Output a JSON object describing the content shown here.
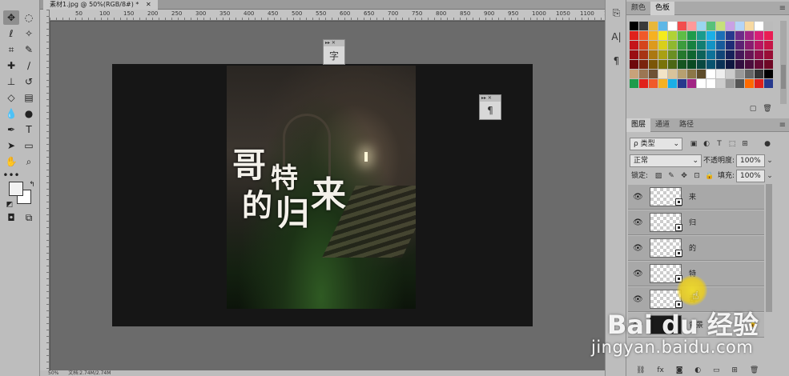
{
  "document": {
    "tab_title": "素材1.jpg @ 50%(RGB/8#) *",
    "ruler_labels": [
      "50",
      "100",
      "150",
      "200",
      "250",
      "300",
      "350",
      "400",
      "450",
      "500",
      "550",
      "600",
      "650",
      "700",
      "750",
      "800",
      "850",
      "900",
      "950",
      "1000",
      "1050",
      "1100",
      "1150"
    ],
    "zoom": "50%",
    "doc_info": "文档:2.74M/2.74M"
  },
  "artwork": {
    "title_chars": [
      "哥",
      "特",
      "的",
      "归",
      "来"
    ]
  },
  "floating_panels": [
    {
      "name": "character-panel",
      "icon": "字"
    },
    {
      "name": "paragraph-panel",
      "icon": "¶"
    }
  ],
  "color_panel": {
    "tabs": [
      "颜色",
      "色板"
    ],
    "active_tab": "色板",
    "swatches": [
      "#000000",
      "#3a3a3a",
      "#e8b73a",
      "#5eb7e6",
      "#ffffff",
      "#f24d4d",
      "#ff9999",
      "#9ad6f0",
      "#57c17a",
      "#c6e07b",
      "#c9a1e5",
      "#b3d4f7",
      "#f7d9a1",
      "#ffffff",
      "#bbbbbb",
      "#e0211c",
      "#f0592a",
      "#f6b121",
      "#f5ec1c",
      "#b0d235",
      "#5ebd46",
      "#1e9b4b",
      "#199b8d",
      "#1aafe6",
      "#1b6fb7",
      "#27398d",
      "#6e2c88",
      "#a22585",
      "#d81e76",
      "#ea1c54",
      "#c4151a",
      "#d4441d",
      "#dd9a1c",
      "#d8cf1a",
      "#8fb82f",
      "#3c9c3d",
      "#178140",
      "#127e72",
      "#1393c4",
      "#175b9b",
      "#1e2c76",
      "#5c2273",
      "#8a1d6f",
      "#b81763",
      "#c61547",
      "#9a0e12",
      "#a73414",
      "#ab7811",
      "#a9a013",
      "#6b8f22",
      "#25782d",
      "#0f6530",
      "#0d6259",
      "#0d7299",
      "#104578",
      "#16215a",
      "#461859",
      "#6a1555",
      "#8e104b",
      "#990e36",
      "#6e080b",
      "#7a240d",
      "#7b5608",
      "#79730b",
      "#4c6716",
      "#155520",
      "#094a22",
      "#084840",
      "#08536f",
      "#0a3156",
      "#0e1640",
      "#320f40",
      "#4c0d3d",
      "#660935",
      "#6e0725",
      "#c8a27a",
      "#9b7653",
      "#6f5134",
      "#f2e3c6",
      "#d8c39b",
      "#b7a070",
      "#8c7647",
      "#5e4c2a",
      "#ffffff",
      "#eeeeee",
      "#cccccc",
      "#999999",
      "#666666",
      "#333333",
      "#000000",
      "#1e9b4b",
      "#e0211c",
      "#f0592a",
      "#f6b121",
      "#1aafe6",
      "#27398d",
      "#a22585",
      "#ffffff",
      "#ffffff",
      "#cccccc",
      "#999999",
      "#555555",
      "#ff6a00",
      "#e0211c",
      "#27398d"
    ]
  },
  "layers_panel": {
    "tabs": [
      "图层",
      "通道",
      "路径"
    ],
    "active_tab": "图层",
    "filter_label": "ρ 类型",
    "blend_mode": "正常",
    "opacity_label": "不透明度:",
    "opacity_value": "100%",
    "lock_label": "锁定:",
    "fill_label": "填充:",
    "fill_value": "100%",
    "layers": [
      {
        "name": "来"
      },
      {
        "name": "归"
      },
      {
        "name": "的"
      },
      {
        "name": "特"
      },
      {
        "name": "哥"
      }
    ],
    "background_layer_label": "背景"
  },
  "watermark": {
    "logo_text": "Bai du 经验",
    "url": "jingyan.baidu.com"
  }
}
